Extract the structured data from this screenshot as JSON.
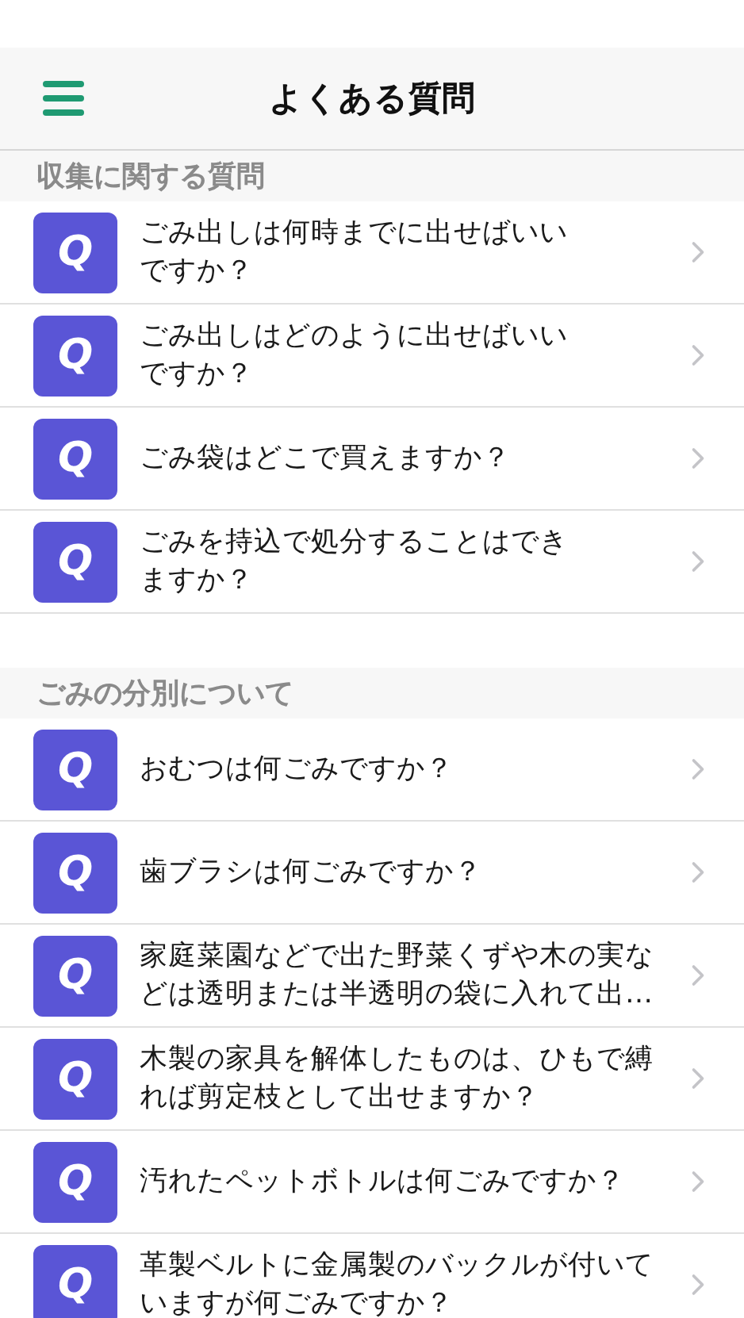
{
  "header": {
    "title": "よくある質問"
  },
  "sections": [
    {
      "title": "収集に関する質問",
      "items": [
        {
          "badge": "Q",
          "lines": [
            "ごみ出しは何時までに出せばいい",
            "ですか？"
          ]
        },
        {
          "badge": "Q",
          "lines": [
            "ごみ出しはどのように出せばいい",
            "ですか？"
          ]
        },
        {
          "badge": "Q",
          "lines": [
            "ごみ袋はどこで買えますか？"
          ]
        },
        {
          "badge": "Q",
          "lines": [
            "ごみを持込で処分することはでき",
            "ますか？"
          ]
        }
      ]
    },
    {
      "title": "ごみの分別について",
      "items": [
        {
          "badge": "Q",
          "lines": [
            "おむつは何ごみですか？"
          ]
        },
        {
          "badge": "Q",
          "lines": [
            "歯ブラシは何ごみですか？"
          ]
        },
        {
          "badge": "Q",
          "lines": [
            "家庭菜園などで出た野菜くずや木の実な",
            "どは透明または半透明の袋に入れて出…"
          ]
        },
        {
          "badge": "Q",
          "lines": [
            "木製の家具を解体したものは、ひもで縛",
            "れば剪定枝として出せますか？"
          ]
        },
        {
          "badge": "Q",
          "lines": [
            "汚れたペットボトルは何ごみですか？"
          ]
        },
        {
          "badge": "Q",
          "lines": [
            "革製ベルトに金属製のバックルが付いて",
            "いますが何ごみですか？"
          ]
        }
      ]
    }
  ]
}
